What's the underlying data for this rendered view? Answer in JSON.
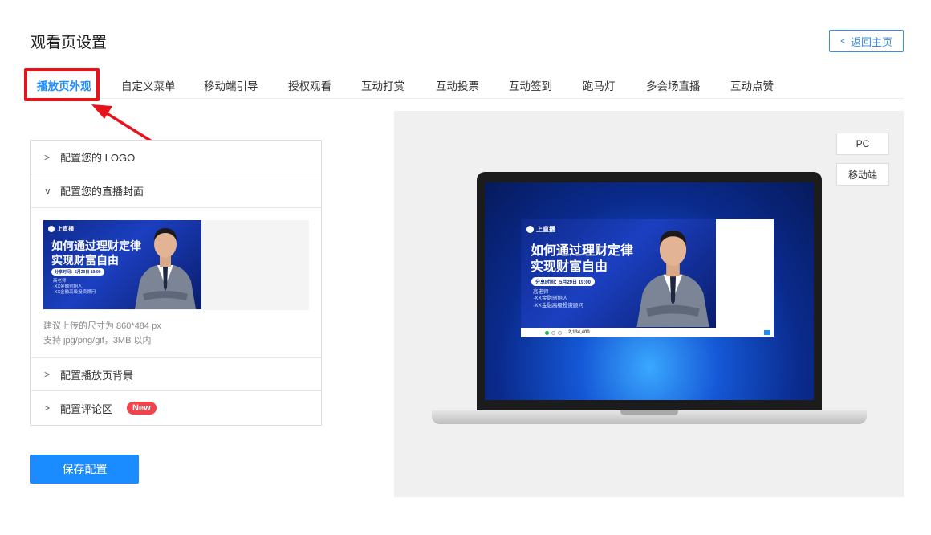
{
  "header": {
    "title": "观看页设置",
    "back_label": "返回主页"
  },
  "tabs": [
    {
      "label": "播放页外观",
      "active": true
    },
    {
      "label": "自定义菜单"
    },
    {
      "label": "移动端引导"
    },
    {
      "label": "授权观看"
    },
    {
      "label": "互动打赏"
    },
    {
      "label": "互动投票"
    },
    {
      "label": "互动签到"
    },
    {
      "label": "跑马灯"
    },
    {
      "label": "多会场直播"
    },
    {
      "label": "互动点赞"
    }
  ],
  "settings": {
    "logo_label": "配置您的 LOGO",
    "cover_label": "配置您的直播封面",
    "cover_hint_size": "建议上传的尺寸为 860*484 px",
    "cover_hint_format": "支持 jpg/png/gif，3MB 以内",
    "background_label": "配置播放页背景",
    "comment_label": "配置评论区",
    "new_badge": "New"
  },
  "save_label": "保存配置",
  "preview": {
    "pc_label": "PC",
    "mobile_label": "移动端"
  },
  "cover": {
    "brand": "上直播",
    "title_line1": "如何通过理财定律",
    "title_line2": "实现财富自由",
    "share_time": "分享时间：5月29日 19:00",
    "teacher": "高老师",
    "role1": "·XX金融创始人",
    "role2": "·XX金融高级投资顾问"
  },
  "player_bar": {
    "view_count": "2,134,400"
  },
  "colors": {
    "accent": "#1a8cff",
    "highlight": "#e8121b",
    "badge": "#f0434a"
  }
}
